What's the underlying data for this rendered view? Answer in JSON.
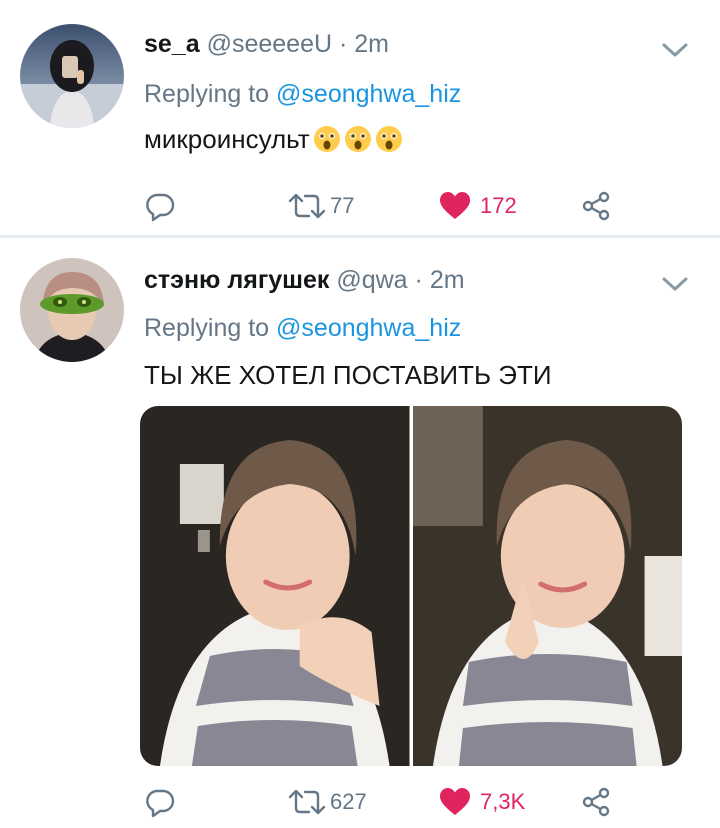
{
  "tweets": [
    {
      "display_name": "se_a",
      "handle": "@seeeeeU",
      "separator": "·",
      "time": "2m",
      "replying_prefix": "Replying to",
      "replying_to": "@seonghwa_hiz",
      "text": "микроинсульт",
      "emoji": [
        "astonished-face",
        "astonished-face",
        "astonished-face"
      ],
      "actions": {
        "reply_icon": "comment-icon",
        "retweet_count": "77",
        "like_count": "172",
        "share_icon": "share-icon"
      }
    },
    {
      "display_name": "стэню лягушек",
      "handle": "@qwa",
      "separator": "·",
      "time": "2m",
      "replying_prefix": "Replying to",
      "replying_to": "@seonghwa_hiz",
      "text": "ТЫ ЖЕ ХОТЕЛ ПОСТАВИТЬ ЭТИ",
      "media_count": 2,
      "actions": {
        "reply_icon": "comment-icon",
        "retweet_count": "627",
        "like_count": "7,3K",
        "share_icon": "share-icon"
      }
    }
  ],
  "colors": {
    "text_primary": "#14171a",
    "text_secondary": "#657786",
    "link_blue": "#1b95e0",
    "like_red": "#e0245e",
    "divider": "#e6ecf0"
  }
}
